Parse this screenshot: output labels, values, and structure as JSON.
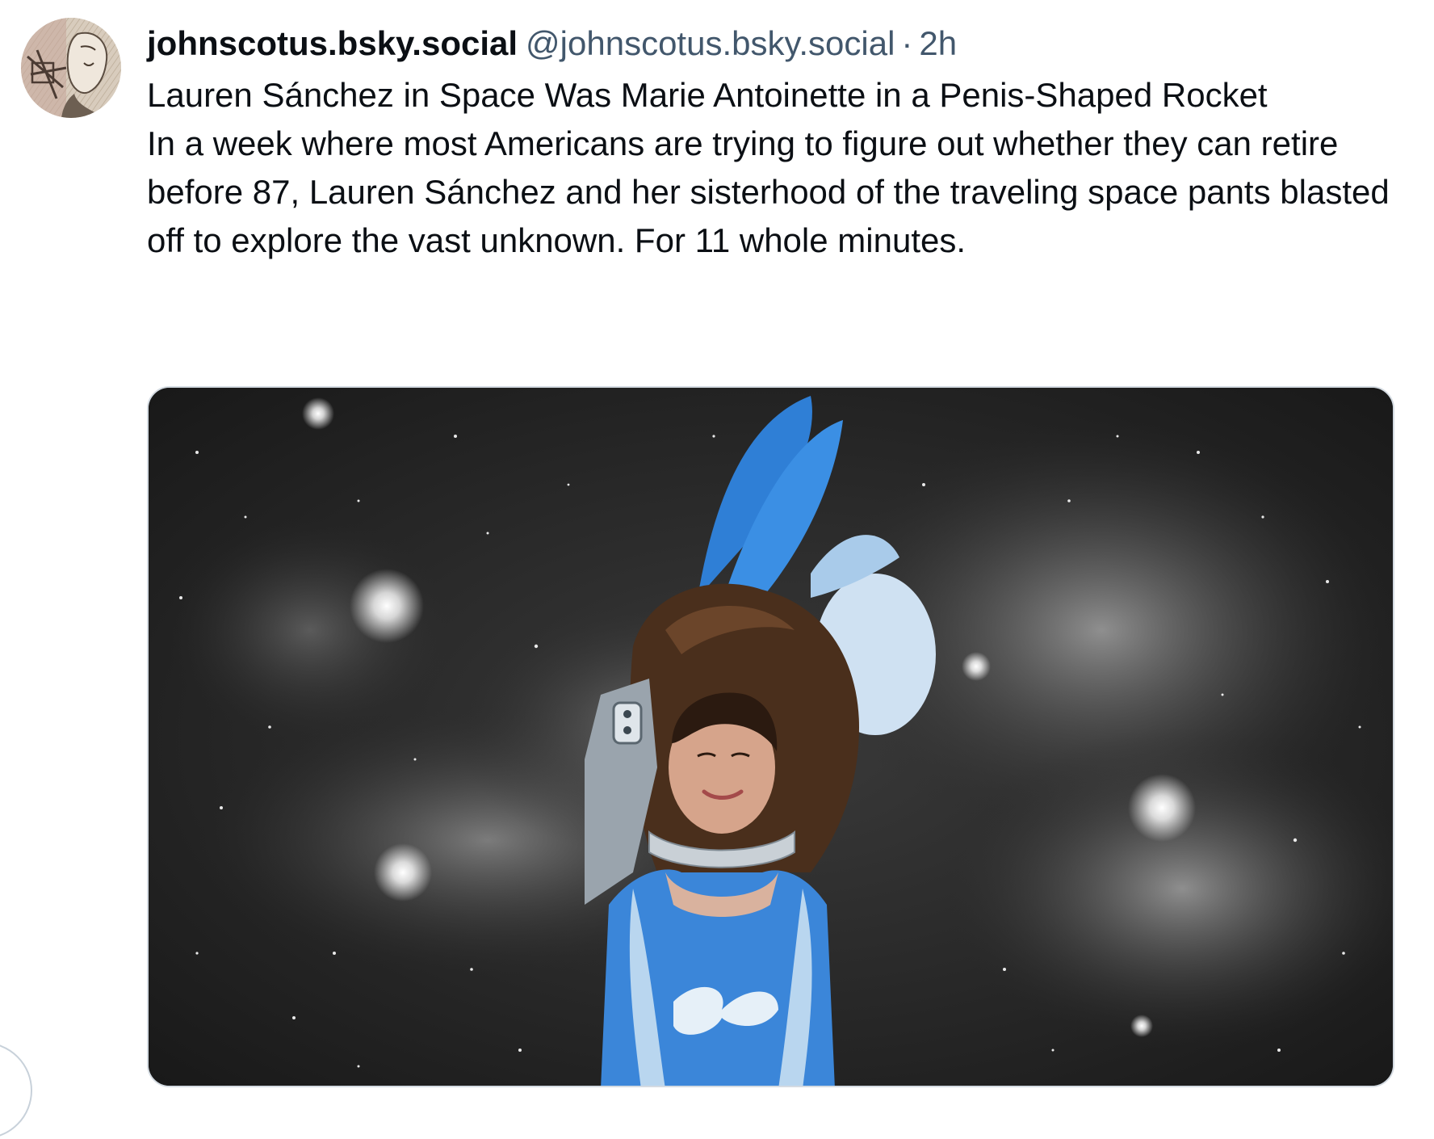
{
  "post": {
    "author": {
      "display_name": "johnscotus.bsky.social",
      "handle": "@johnscotus.bsky.social",
      "avatar_icon": "etching-portrait-avatar"
    },
    "separator": "·",
    "timestamp": "2h",
    "title": "Lauren Sánchez in Space Was Marie Antoinette in a Penis-Shaped Rocket",
    "body": "In a week where most Americans are trying to figure out whether they can retire before 87, Lauren Sánchez and her sisterhood of the traveling space pants blasted off to explore the vast unknown. For 11 whole minutes."
  },
  "colors": {
    "text_primary": "#0b0f14",
    "text_secondary": "#42576c",
    "border": "#d4dbe2"
  }
}
